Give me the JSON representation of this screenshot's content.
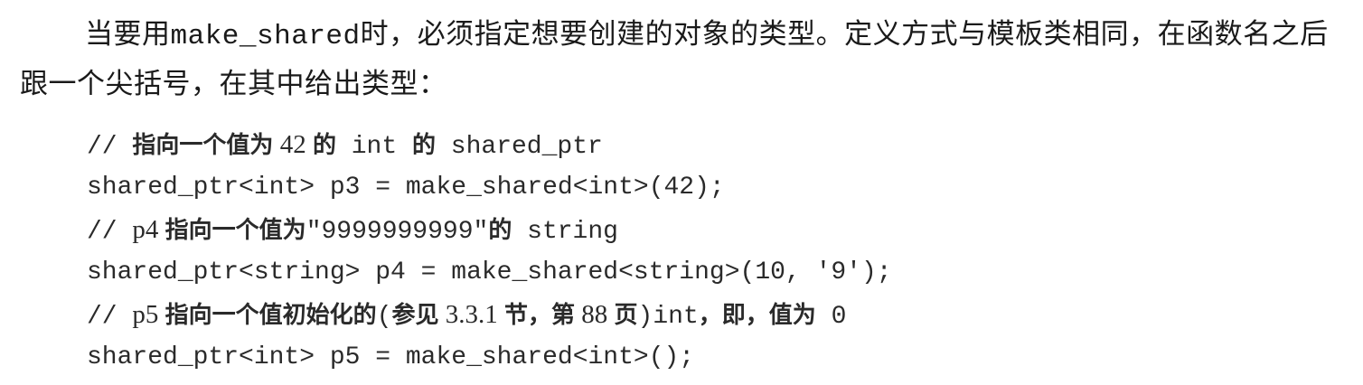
{
  "paragraph": {
    "part1": "当要用",
    "code": "make_shared",
    "part2": "时，必须指定想要创建的对象的类型。定义方式与模板类相同，在函数名之后跟一个尖括号，在其中给出类型："
  },
  "code_lines": [
    {
      "type": "comment",
      "parts": [
        {
          "kind": "mono",
          "text": "// "
        },
        {
          "kind": "cjk",
          "text": "指向一个值为"
        },
        {
          "kind": "num",
          "text": " 42 "
        },
        {
          "kind": "cjk",
          "text": "的"
        },
        {
          "kind": "mono",
          "text": " int "
        },
        {
          "kind": "cjk",
          "text": "的"
        },
        {
          "kind": "mono",
          "text": " shared_ptr"
        }
      ]
    },
    {
      "type": "code",
      "text": "shared_ptr<int> p3 = make_shared<int>(42);"
    },
    {
      "type": "comment",
      "parts": [
        {
          "kind": "mono",
          "text": "// "
        },
        {
          "kind": "num",
          "text": "p4 "
        },
        {
          "kind": "cjk",
          "text": "指向一个值为"
        },
        {
          "kind": "mono",
          "text": "\"9999999999\""
        },
        {
          "kind": "cjk",
          "text": "的"
        },
        {
          "kind": "mono",
          "text": " string"
        }
      ]
    },
    {
      "type": "code",
      "text": "shared_ptr<string> p4 = make_shared<string>(10, '9');"
    },
    {
      "type": "comment",
      "parts": [
        {
          "kind": "mono",
          "text": "// "
        },
        {
          "kind": "num",
          "text": "p5 "
        },
        {
          "kind": "cjk",
          "text": "指向一个值初始化的"
        },
        {
          "kind": "mono",
          "text": "("
        },
        {
          "kind": "cjk",
          "text": "参见"
        },
        {
          "kind": "num",
          "text": " 3.3.1 "
        },
        {
          "kind": "cjk",
          "text": "节，第"
        },
        {
          "kind": "num",
          "text": " 88 "
        },
        {
          "kind": "cjk",
          "text": "页"
        },
        {
          "kind": "mono",
          "text": ")int"
        },
        {
          "kind": "cjk",
          "text": "，即，值为"
        },
        {
          "kind": "mono",
          "text": " 0"
        }
      ]
    },
    {
      "type": "code",
      "text": "shared_ptr<int> p5 = make_shared<int>();"
    }
  ]
}
